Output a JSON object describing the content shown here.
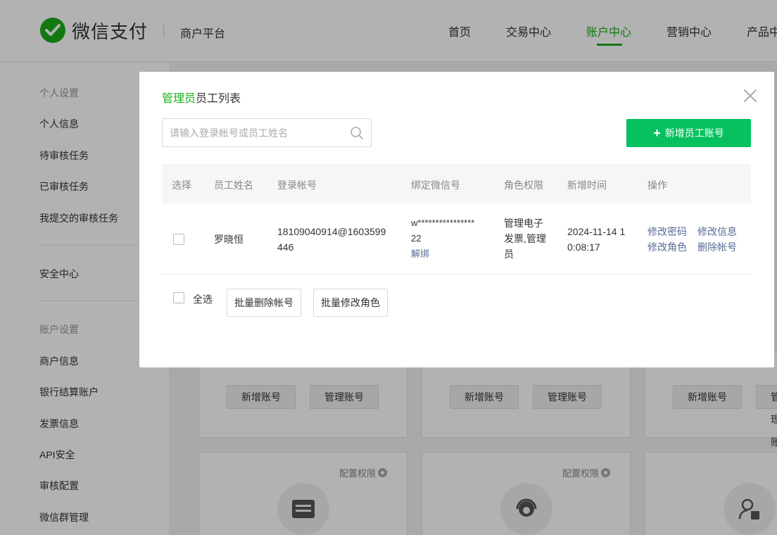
{
  "header": {
    "logo_text": "微信支付",
    "platform": "商户平台",
    "nav": [
      {
        "label": "首页"
      },
      {
        "label": "交易中心"
      },
      {
        "label": "账户中心"
      },
      {
        "label": "营销中心"
      },
      {
        "label": "产品中"
      }
    ],
    "active_nav": "账户中心",
    "accent_color": "#1aad19"
  },
  "sidebar": {
    "section1_title": "个人设置",
    "section1_items": [
      "个人信息",
      "待审核任务",
      "已审核任务",
      "我提交的审核任务"
    ],
    "security": "安全中心",
    "section2_title": "账户设置",
    "section2_items": [
      "商户信息",
      "银行结算账户",
      "发票信息",
      "API安全",
      "审核配置",
      "微信群管理"
    ]
  },
  "background_cards": {
    "add_account": "新增账号",
    "manage_account": "管理账号",
    "config_permission": "配置权限"
  },
  "modal": {
    "title_highlight": "管理员",
    "title_rest": "员工列表",
    "search_placeholder": "请输入登录帐号或员工姓名",
    "add_button": "新增员工账号",
    "columns": [
      "选择",
      "员工姓名",
      "登录帐号",
      "绑定微信号",
      "角色权限",
      "新增时间",
      "操作"
    ],
    "rows": [
      {
        "name": "罗晓恒",
        "login_line1": "18109040914@1603599",
        "login_line2": "446",
        "wechat_line1": "w****************",
        "wechat_line2": "22",
        "unbind": "解绑",
        "role_line1": "管理电子",
        "role_line2": "发票,管理",
        "role_line3": "员",
        "time_line1": "2024-11-14 1",
        "time_line2": "0:08:17",
        "actions": [
          "修改密码",
          "修改信息",
          "修改角色",
          "删除帐号"
        ]
      }
    ],
    "select_all": "全选",
    "batch_delete": "批量删除帐号",
    "batch_modify_role": "批量修改角色",
    "primary_color": "#07c160",
    "link_color": "#576b95"
  }
}
